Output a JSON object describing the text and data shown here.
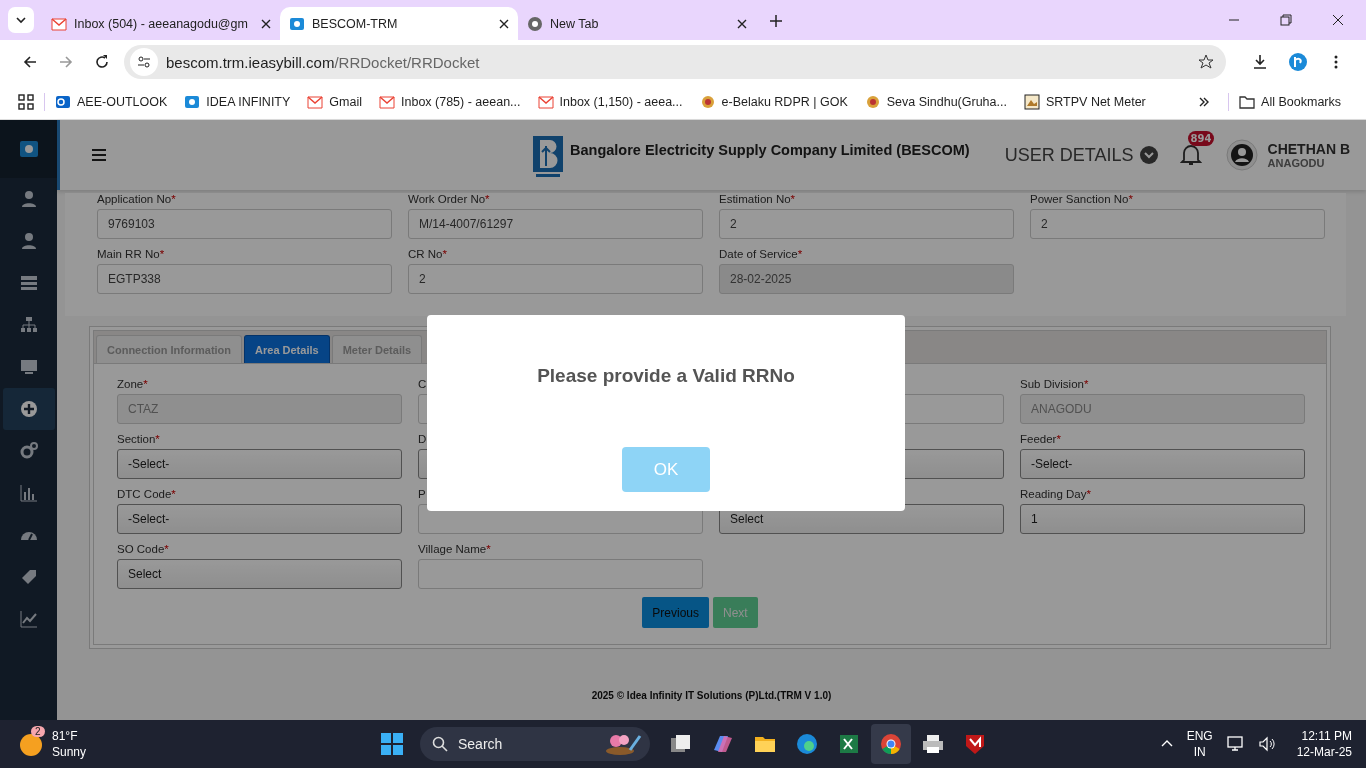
{
  "browser": {
    "tabs": [
      {
        "title": "Inbox (504) - aeeanagodu@gm",
        "selected": false
      },
      {
        "title": "BESCOM-TRM",
        "selected": true
      },
      {
        "title": "New Tab",
        "selected": false
      }
    ],
    "url": {
      "host": "bescom.trm.ieasybill.com",
      "path": "/RRDocket/RRDocket"
    },
    "bookmarks": [
      "AEE-OUTLOOK",
      "IDEA INFINITY",
      "Gmail",
      "Inbox (785) - aeean...",
      "Inbox (1,150) - aeea...",
      "e-Belaku RDPR | GOK",
      "Seva Sindhu(Gruha...",
      "SRTPV Net Meter"
    ],
    "all_bookmarks": "All Bookmarks"
  },
  "sidebar": {
    "items": [
      {
        "selected": false
      },
      {
        "selected": false
      },
      {
        "selected": false
      },
      {
        "selected": false
      },
      {
        "selected": false
      },
      {
        "selected": true
      },
      {
        "selected": false
      },
      {
        "selected": false
      },
      {
        "selected": false
      },
      {
        "selected": false
      },
      {
        "selected": false
      }
    ]
  },
  "header": {
    "title": "Bangalore Electricity Supply Company Limited (BESCOM)",
    "user_details": "USER DETAILS",
    "notifications": "894",
    "user_name": "CHETHAN B",
    "user_place": "ANAGODU"
  },
  "form": [
    {
      "label": "Application No",
      "mark": "*",
      "value": "9769103",
      "kind": "text"
    },
    {
      "label": "Work Order No",
      "mark": "*",
      "value": "M/14-4007/61297",
      "kind": "text"
    },
    {
      "label": "Estimation No",
      "mark": "*",
      "value": "2",
      "kind": "text"
    },
    {
      "label": "Power Sanction No",
      "mark": "*",
      "value": "2",
      "kind": "text"
    },
    {
      "label": "Main RR No",
      "mark": "*",
      "value": "EGTP338",
      "kind": "text"
    },
    {
      "label": "CR No",
      "mark": "*",
      "value": "2",
      "kind": "text"
    },
    {
      "label": "Date of Service",
      "mark": "*",
      "value": "28-02-2025",
      "kind": "readonly"
    }
  ],
  "tabs": [
    {
      "label": "Connection Information",
      "selected": false
    },
    {
      "label": "Area Details",
      "selected": true
    },
    {
      "label": "Meter Details",
      "selected": false
    }
  ],
  "area_fields": [
    {
      "label": "Zone",
      "mark": "*",
      "value": "CTAZ",
      "kind": "readonly"
    },
    {
      "label": "C",
      "kind": "text"
    },
    {
      "kind": "text"
    },
    {
      "label": "Sub Division",
      "mark": "*",
      "value": "ANAGODU",
      "kind": "readonly"
    },
    {
      "label": "Section",
      "mark": "*",
      "value": "-Select-",
      "kind": "select"
    },
    {
      "label": "D",
      "kind": "select"
    },
    {
      "kind": "select"
    },
    {
      "label": "Feeder",
      "mark": "*",
      "value": "-Select-",
      "kind": "select"
    },
    {
      "label": "DTC Code",
      "mark": "*",
      "value": "-Select-",
      "kind": "select"
    },
    {
      "label": "P",
      "kind": "text"
    },
    {
      "value": "Select",
      "kind": "select"
    },
    {
      "label": "Reading Day",
      "mark": "*",
      "value": "1",
      "kind": "select"
    },
    {
      "label": "SO Code",
      "mark": "*",
      "value": "Select",
      "kind": "select"
    },
    {
      "label": "Village Name",
      "mark": "*",
      "kind": "text"
    }
  ],
  "buttons": {
    "previous": "Previous",
    "next": "Next"
  },
  "footer": "2025 © Idea Infinity IT Solutions (P)Ltd.(TRM V 1.0)",
  "dialog": {
    "message": "Please provide a Valid RRNo",
    "ok": "OK"
  },
  "taskbar": {
    "weather_badge": "2",
    "temperature": "81°F",
    "condition": "Sunny",
    "search": "Search",
    "apps": [
      {
        "selected": false
      },
      {
        "selected": false
      },
      {
        "selected": false
      },
      {
        "selected": false
      },
      {
        "selected": false
      },
      {
        "selected": true
      },
      {
        "selected": false
      },
      {
        "selected": false
      }
    ],
    "language": "ENG",
    "region": "IN",
    "time": "12:11 PM",
    "date": "12-Mar-25"
  }
}
